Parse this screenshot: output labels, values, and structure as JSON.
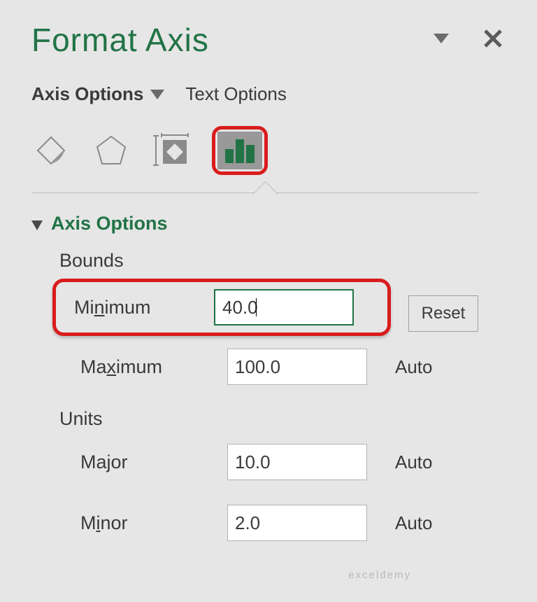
{
  "header": {
    "title": "Format Axis"
  },
  "tabs": {
    "axis_options": "Axis Options",
    "text_options": "Text Options"
  },
  "section": {
    "title": "Axis Options"
  },
  "groups": {
    "bounds": "Bounds",
    "units": "Units"
  },
  "fields": {
    "minimum": {
      "label_pre": "Mi",
      "label_u": "n",
      "label_post": "imum",
      "value": "40.0",
      "action": "Reset"
    },
    "maximum": {
      "label_pre": "Ma",
      "label_u": "x",
      "label_post": "imum",
      "value": "100.0",
      "action": "Auto"
    },
    "major": {
      "label_pre": "Ma",
      "label_u": "j",
      "label_post": "or",
      "value": "10.0",
      "action": "Auto"
    },
    "minor": {
      "label_pre": "M",
      "label_u": "i",
      "label_post": "nor",
      "value": "2.0",
      "action": "Auto"
    }
  },
  "watermark": "exceldemy"
}
